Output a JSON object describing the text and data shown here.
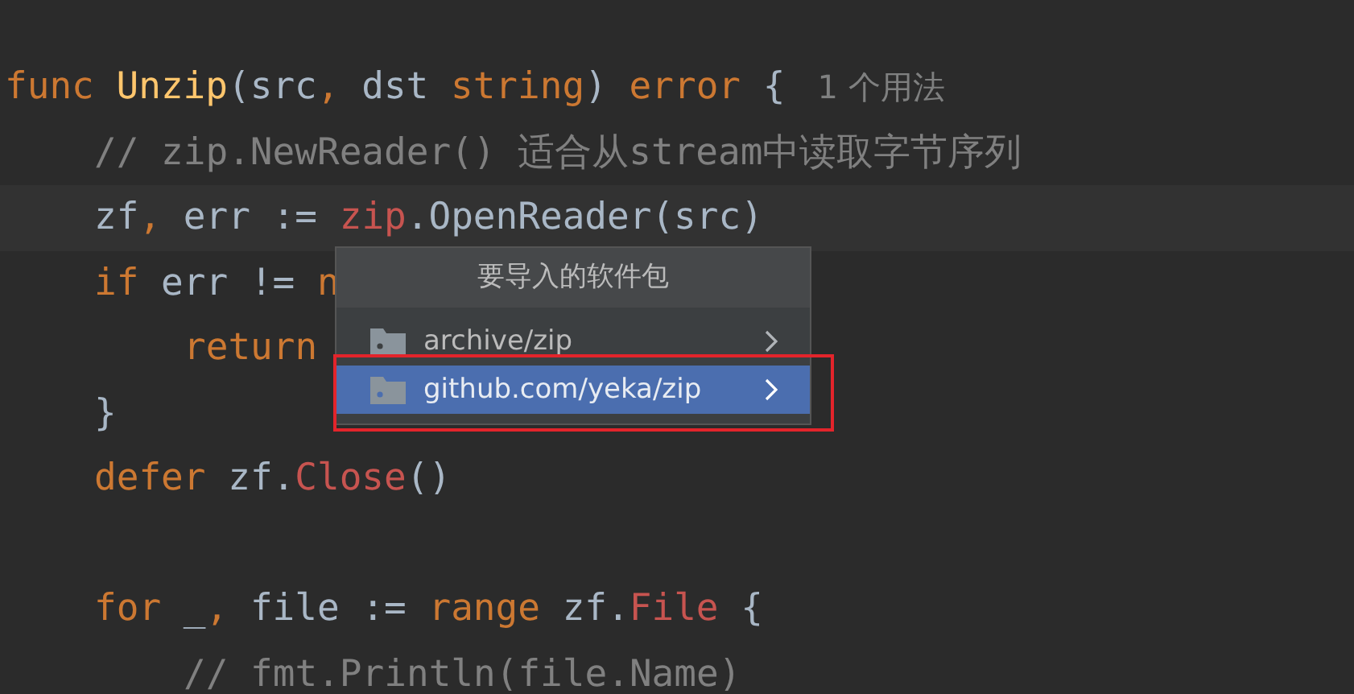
{
  "editor": {
    "lines": [
      {
        "current": false,
        "tokens": [
          {
            "kind": "keyword",
            "text": "func "
          },
          {
            "kind": "function",
            "text": "Unzip"
          },
          {
            "kind": "plain",
            "text": "(src"
          },
          {
            "kind": "keyword",
            "text": ", "
          },
          {
            "kind": "plain",
            "text": "dst "
          },
          {
            "kind": "keyword",
            "text": "string"
          },
          {
            "kind": "plain",
            "text": ") "
          },
          {
            "kind": "keyword",
            "text": "error"
          },
          {
            "kind": "plain",
            "text": " {"
          }
        ],
        "hint": "1 个用法",
        "children": [
          {
            "current": false,
            "tokens": [
              {
                "kind": "comment",
                "text": "// zip.NewReader() 适合从stream中读取字节序列"
              }
            ]
          },
          {
            "current": true,
            "tokens": [
              {
                "kind": "plain",
                "text": "zf"
              },
              {
                "kind": "keyword",
                "text": ", "
              },
              {
                "kind": "plain",
                "text": "err := "
              },
              {
                "kind": "package",
                "text": "zip"
              },
              {
                "kind": "plain",
                "text": ".OpenReader(src)"
              }
            ]
          },
          {
            "current": false,
            "tokens": [
              {
                "kind": "keyword",
                "text": "if "
              },
              {
                "kind": "plain",
                "text": "err != "
              },
              {
                "kind": "keyword",
                "text": "n"
              }
            ],
            "children": [
              {
                "current": false,
                "tokens": [
                  {
                    "kind": "keyword",
                    "text": "return"
                  }
                ]
              }
            ]
          },
          {
            "current": false,
            "tokens": [
              {
                "kind": "plain",
                "text": "}"
              }
            ]
          },
          {
            "current": false,
            "tokens": [
              {
                "kind": "keyword",
                "text": "defer "
              },
              {
                "kind": "plain",
                "text": "zf."
              },
              {
                "kind": "package",
                "text": "Close"
              },
              {
                "kind": "plain",
                "text": "()"
              }
            ]
          },
          {
            "kind": "blank"
          },
          {
            "current": false,
            "tokens": [
              {
                "kind": "keyword",
                "text": "for "
              },
              {
                "kind": "plain",
                "text": "_"
              },
              {
                "kind": "keyword",
                "text": ", "
              },
              {
                "kind": "plain",
                "text": "file := "
              },
              {
                "kind": "keyword",
                "text": "range "
              },
              {
                "kind": "plain",
                "text": "zf."
              },
              {
                "kind": "package",
                "text": "File"
              },
              {
                "kind": "plain",
                "text": " {"
              }
            ],
            "children": [
              {
                "current": false,
                "tokens": [
                  {
                    "kind": "comment",
                    "text": "// fmt.Println(file.Name)"
                  }
                ]
              }
            ]
          }
        ]
      }
    ]
  },
  "popup": {
    "title": "要导入的软件包",
    "items": [
      {
        "label": "archive/zip",
        "selected": false,
        "annotated": false
      },
      {
        "label": "github.com/yeka/zip",
        "selected": true,
        "annotated": true
      }
    ]
  }
}
